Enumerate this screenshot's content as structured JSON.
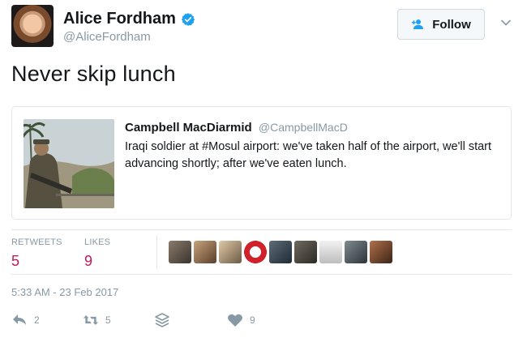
{
  "tweet": {
    "author": {
      "display_name": "Alice Fordham",
      "handle": "@AliceFordham",
      "verified": true
    },
    "follow_label": "Follow",
    "text": "Never skip lunch",
    "timestamp": "5:33 AM - 23 Feb 2017"
  },
  "quoted": {
    "display_name": "Campbell MacDiarmid",
    "handle": "@CampbellMacD",
    "text": "Iraqi soldier at #Mosul airport: we've taken half of the airport, we'll start advancing shortly; after we've eaten lunch."
  },
  "stats": {
    "retweets_label": "RETWEETS",
    "retweets": "5",
    "likes_label": "LIKES",
    "likes": "9"
  },
  "actions": {
    "reply_count": "2",
    "retweet_count": "5",
    "like_count": "9"
  },
  "colors": {
    "accent_pink": "#c2185b",
    "muted": "#8899a6",
    "verified_blue": "#1da1f2"
  },
  "icons": [
    "verified-badge-icon",
    "follow-person-icon",
    "chevron-down-icon",
    "reply-icon",
    "retweet-icon",
    "layers-icon",
    "heart-icon"
  ]
}
